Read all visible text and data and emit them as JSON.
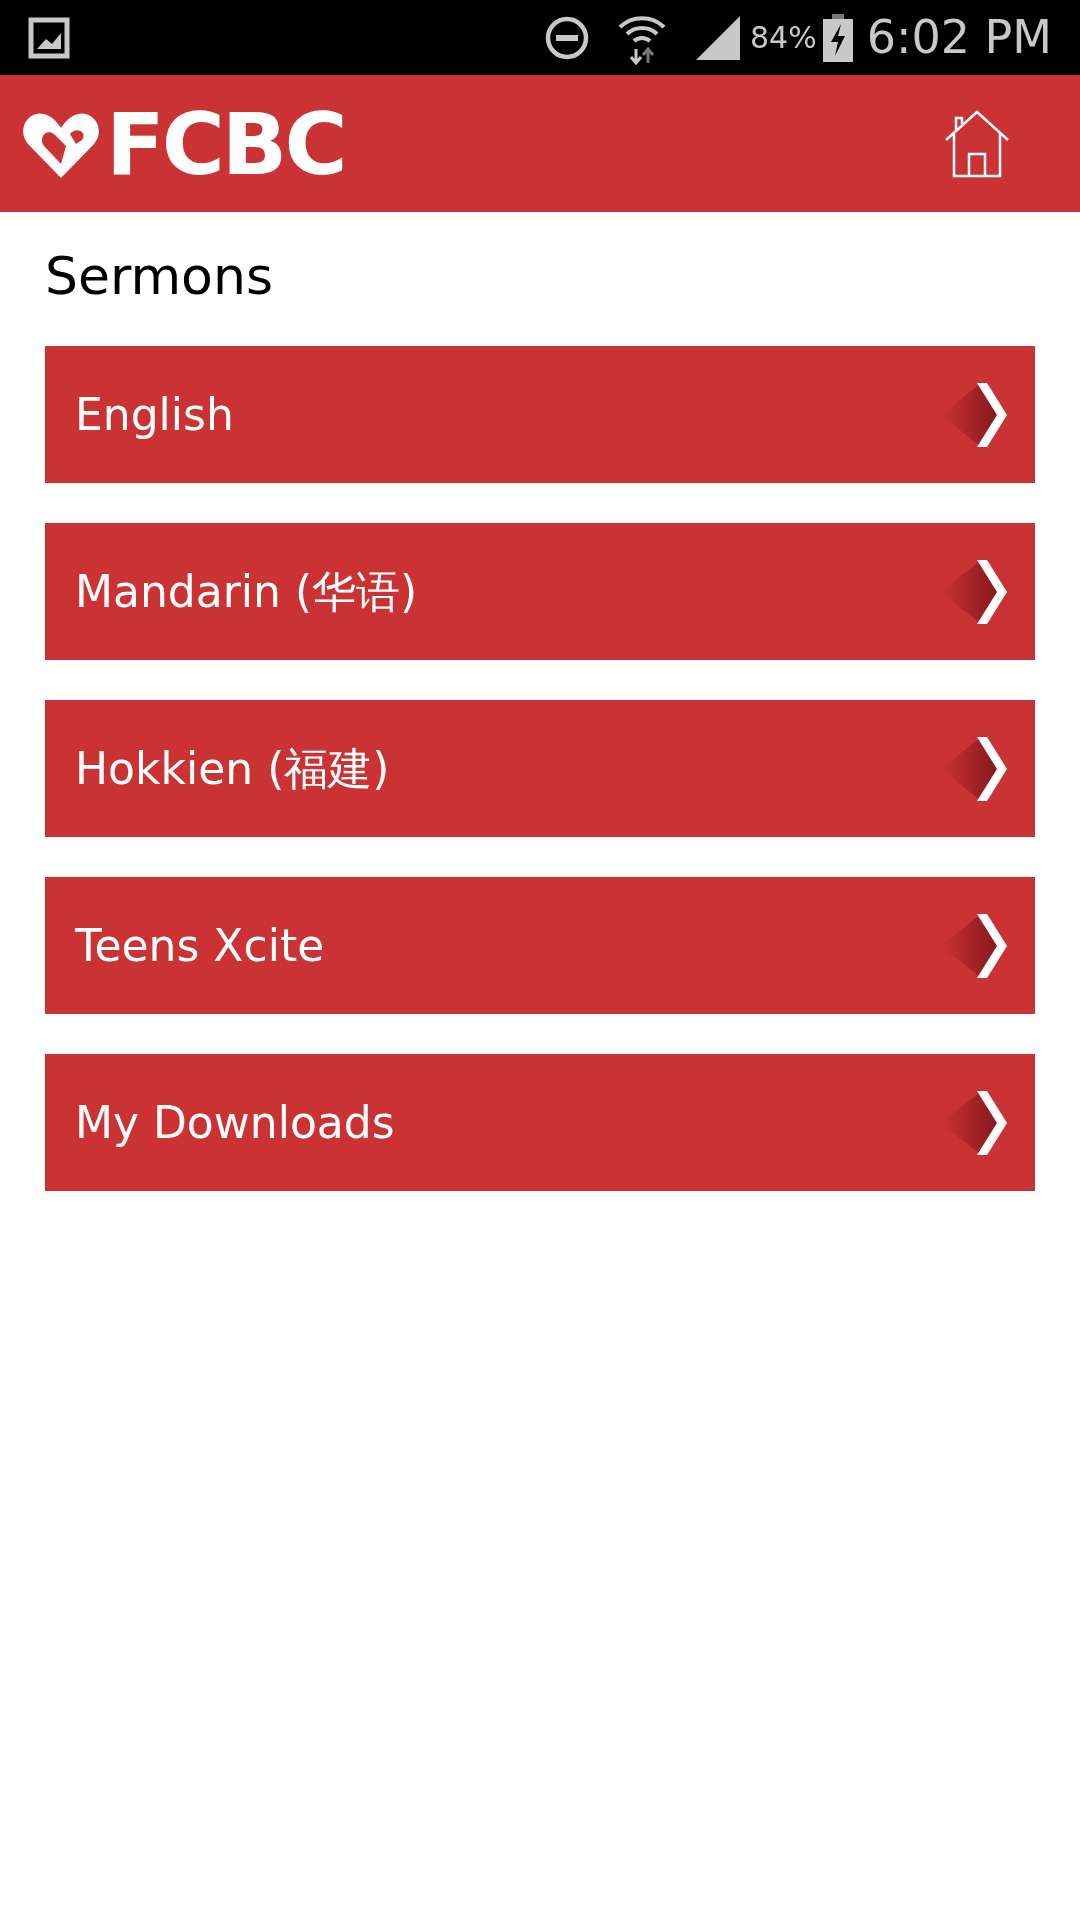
{
  "status_bar": {
    "battery": "84%",
    "time": "6:02 PM"
  },
  "header": {
    "logo": "FCBC"
  },
  "title": "Sermons",
  "items": [
    {
      "label": "English"
    },
    {
      "label": "Mandarin (华语)"
    },
    {
      "label": "Hokkien (福建)"
    },
    {
      "label": "Teens Xcite"
    },
    {
      "label": "My Downloads"
    }
  ]
}
